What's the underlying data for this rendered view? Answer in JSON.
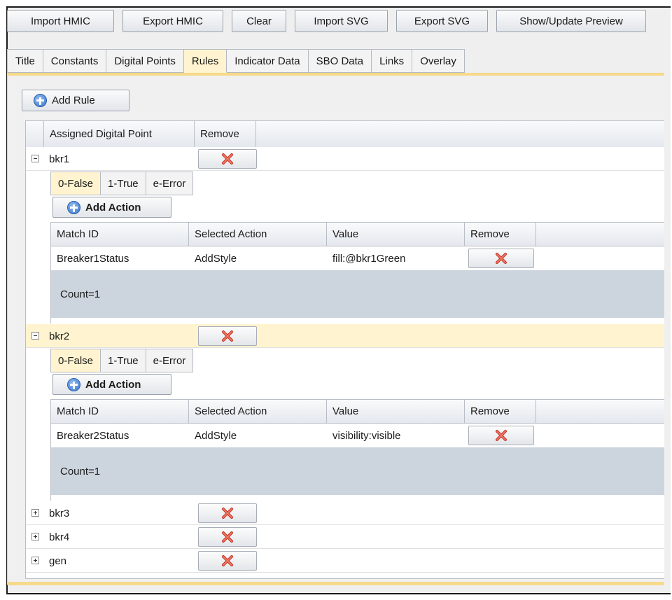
{
  "toolbar": {
    "import_hmic": "Import HMIC",
    "export_hmic": "Export HMIC",
    "clear": "Clear",
    "import_svg": "Import SVG",
    "export_svg": "Export SVG",
    "show_update_preview": "Show/Update Preview"
  },
  "tabs": [
    "Title",
    "Constants",
    "Digital Points",
    "Rules",
    "Indicator Data",
    "SBO Data",
    "Links",
    "Overlay"
  ],
  "active_tab": "Rules",
  "rules": {
    "add_rule_label": "Add Rule",
    "columns": [
      "Assigned Digital Point",
      "Remove"
    ],
    "items": [
      {
        "name": "bkr1",
        "expanded": true,
        "subtabs": [
          "0-False",
          "1-True",
          "e-Error"
        ],
        "active_subtab": "0-False",
        "add_action_label": "Add Action",
        "action_columns": [
          "Match ID",
          "Selected Action",
          "Value",
          "Remove"
        ],
        "actions": [
          {
            "match_id": "Breaker1Status",
            "selected_action": "AddStyle",
            "value": "fill:@bkr1Green"
          }
        ],
        "count_label": "Count=1"
      },
      {
        "name": "bkr2",
        "expanded": true,
        "selected": true,
        "subtabs": [
          "0-False",
          "1-True",
          "e-Error"
        ],
        "active_subtab": "0-False",
        "add_action_label": "Add Action",
        "action_columns": [
          "Match ID",
          "Selected Action",
          "Value",
          "Remove"
        ],
        "actions": [
          {
            "match_id": "Breaker2Status",
            "selected_action": "AddStyle",
            "value": "visibility:visible"
          }
        ],
        "count_label": "Count=1"
      },
      {
        "name": "bkr3",
        "expanded": false
      },
      {
        "name": "bkr4",
        "expanded": false
      },
      {
        "name": "gen",
        "expanded": false
      }
    ]
  },
  "icons": {
    "add": "plus-circle-icon",
    "remove": "red-x-icon",
    "expand": "tree-plus-icon",
    "collapse": "tree-minus-icon"
  },
  "colors": {
    "active_tab_bg": "#fff4cf",
    "selected_row_bg": "#fff4cf",
    "count_bar_bg": "#ccd4dd",
    "panel_accent": "#f6d98a"
  }
}
